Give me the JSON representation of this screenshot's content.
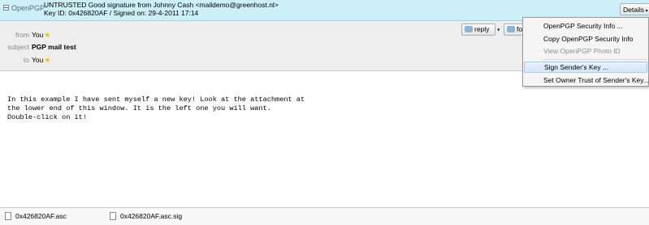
{
  "banner": {
    "label": "OpenPGP",
    "line1": "UNTRUSTED Good signature from Johnny Cash <maildemo@greenhost.nl>",
    "line2": "Key ID: 0x426820AF / Signed on: 29-4-2011 17:14",
    "details_button": "Details"
  },
  "header": {
    "from_label": "from",
    "from_value": "You",
    "subject_label": "subject",
    "subject_value": "PGP mail test",
    "to_label": "to",
    "to_value": "You",
    "reply_button": "reply",
    "forward_button": "fo"
  },
  "message": {
    "body": "In this example I have sent myself a new key! Look at the attachment at\nthe lower end of this window. It is the left one you will want.\nDouble-click on it!"
  },
  "attachments": [
    {
      "name": "0x426820AF.asc"
    },
    {
      "name": "0x426820AF.asc.sig"
    }
  ],
  "menu": {
    "items": [
      {
        "label": "OpenPGP Security Info ...",
        "enabled": true
      },
      {
        "label": "Copy OpenPGP Security Info",
        "enabled": true
      },
      {
        "label": "View OpenPGP Photo ID",
        "enabled": false
      },
      {
        "label": "Sign Sender's Key ...",
        "enabled": true,
        "highlighted": true
      },
      {
        "label": "Set Owner Trust of Sender's Key...",
        "enabled": true
      }
    ]
  },
  "colors": {
    "banner_bg": "#cdeff8",
    "header_bg": "#eeeeee",
    "star": "#f2c200",
    "menu_highlight": "#d6e6f7"
  },
  "icons": [
    "openpgp-collapse-icon",
    "star-icon",
    "reply-icon",
    "forward-icon",
    "dropdown-arrow-icon",
    "file-icon"
  ]
}
